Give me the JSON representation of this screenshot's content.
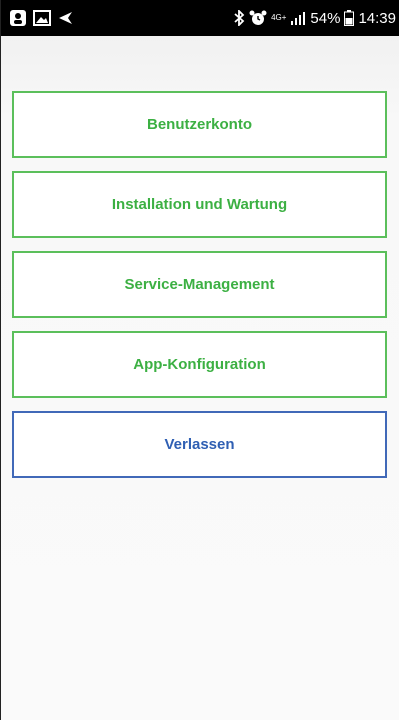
{
  "status_bar": {
    "left_icons": [
      "notification-icon",
      "image-icon",
      "send-icon"
    ],
    "right_icons": [
      "bluetooth-icon",
      "alarm-icon",
      "network-icon",
      "signal-icon",
      "battery-icon"
    ],
    "network_type": "4G+",
    "battery_percent": "54%",
    "time": "14:39"
  },
  "menu": {
    "items": [
      {
        "label": "Benutzerkonto"
      },
      {
        "label": "Installation und Wartung"
      },
      {
        "label": "Service-Management"
      },
      {
        "label": "App-Konfiguration"
      },
      {
        "label": "Verlassen"
      }
    ]
  },
  "colors": {
    "menu_border": "#5bbf5b",
    "menu_text": "#3cb043",
    "exit_border": "#4169b8",
    "exit_text": "#2f5fb3",
    "status_bar": "#000000",
    "background": "#f5f5f5"
  }
}
